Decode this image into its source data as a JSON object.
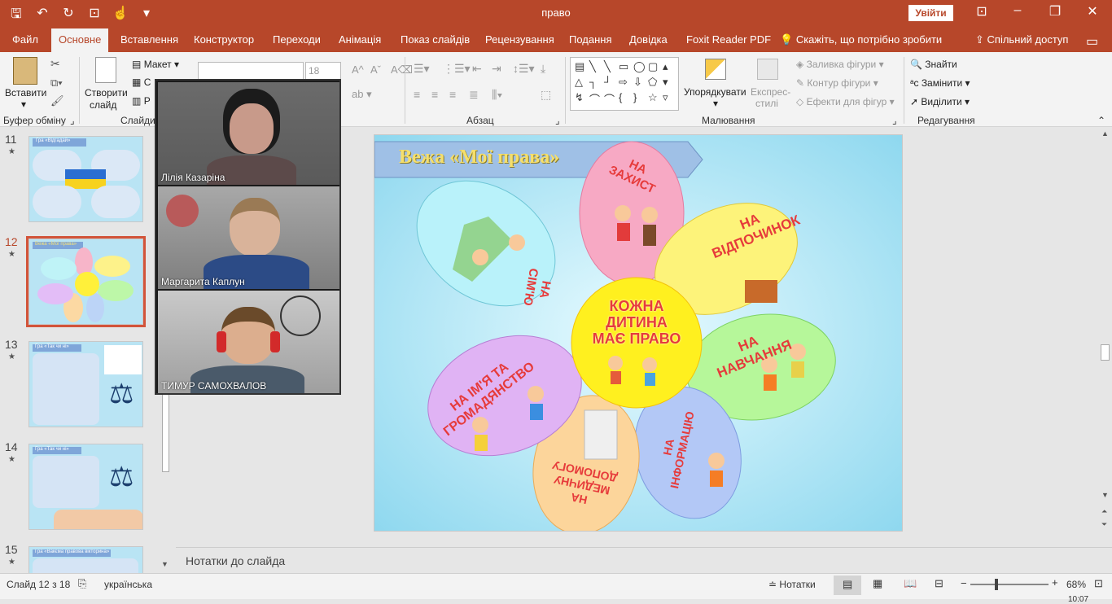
{
  "window": {
    "title": "право",
    "signin_label": "Увійти",
    "colors": {
      "accent": "#b7472a",
      "selection": "#d2543a"
    }
  },
  "qat": {
    "icons": [
      "save-icon",
      "undo-icon",
      "redo-icon",
      "present-icon",
      "touch-icon",
      "customize-icon"
    ]
  },
  "menu": {
    "tabs": [
      "Файл",
      "Основне",
      "Вставлення",
      "Конструктор",
      "Переходи",
      "Анімація",
      "Показ слайдів",
      "Рецензування",
      "Подання",
      "Довідка",
      "Foxit Reader PDF"
    ],
    "active_tab": "Основне",
    "tell_me": "Скажіть, що потрібно зробити",
    "share": "Спільний доступ"
  },
  "ribbon": {
    "clipboard": {
      "paste": "Вставити",
      "group": "Буфер обміну"
    },
    "slides": {
      "new_slide_line1": "Створити",
      "new_slide_line2": "слайд",
      "layout": "Макет",
      "group": "Слайди",
      "partial_c": "С",
      "partial_r": "Р"
    },
    "font": {
      "size": "18"
    },
    "paragraph": {
      "group": "Абзац"
    },
    "drawing": {
      "arrange": "Упорядкувати",
      "quick_styles_line1": "Експрес-",
      "quick_styles_line2": "стилі",
      "fill": "Заливка фігури",
      "outline": "Контур фігури",
      "effects": "Ефекти для фігур",
      "group": "Малювання"
    },
    "editing": {
      "find": "Знайти",
      "replace": "Замінити",
      "select": "Виділити",
      "group": "Редагування"
    }
  },
  "thumbnails": [
    {
      "num": "11",
      "title": "Гра «Відгадай»",
      "selected": false
    },
    {
      "num": "12",
      "title": "Вежа «Мої права»",
      "selected": true
    },
    {
      "num": "13",
      "title": "Гра «Так чи ні»",
      "selected": false
    },
    {
      "num": "14",
      "title": "Гра «Так чи ні»",
      "selected": false
    },
    {
      "num": "15",
      "title": "Гра «Вакєма правова вікторина»",
      "selected": false
    }
  ],
  "video": {
    "participants": [
      "Лілія Казаріна",
      "Маргарита Каплун",
      "ТИМУР  САМОХВАЛОВ"
    ]
  },
  "slide": {
    "title": "Вежа «Мої права»",
    "center": [
      "КОЖНА",
      "ДИТИНА",
      "МАЄ ПРАВО"
    ],
    "petals": {
      "protection": [
        "НА",
        "ЗАХИСТ"
      ],
      "rest": [
        "НА",
        "ВІДПОЧИНОК"
      ],
      "education": [
        "НА",
        "НАВЧАННЯ"
      ],
      "information": [
        "НА",
        "ІНФОРМАЦІЮ"
      ],
      "medical": [
        "НА",
        "МЕДИЧНУ",
        "ДОПОМОГУ"
      ],
      "name": [
        "НА ІМ'Я ТА",
        "ГРОМАДЯНСТВО"
      ],
      "family": [
        "НА",
        "СІМ'Ю"
      ]
    }
  },
  "notes_placeholder": "Нотатки до слайда",
  "status": {
    "slide_count": "Слайд 12 з 18",
    "language": "українська",
    "notes": "Нотатки",
    "zoom": "68%",
    "clock": "10:07"
  }
}
